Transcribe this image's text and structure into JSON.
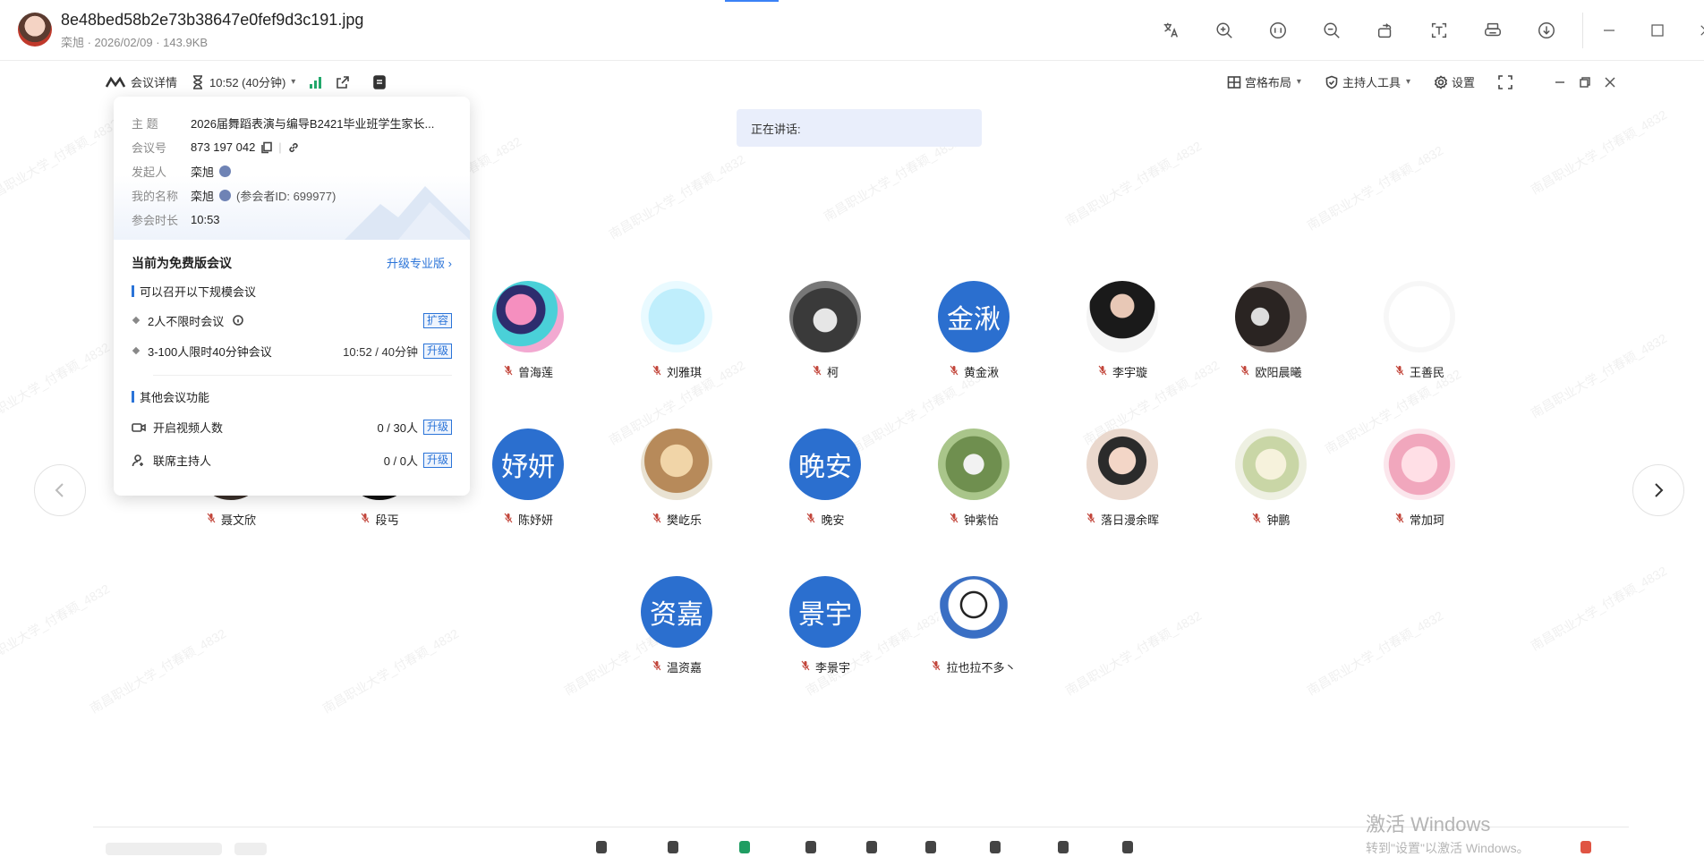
{
  "viewer": {
    "filename": "8e48bed58b2e73b38647e0fef9d3c191.jpg",
    "meta": "栾旭 · 2026/02/09 · 143.9KB",
    "tools": [
      "translate-icon",
      "zoom-in-icon",
      "actual-size-icon",
      "zoom-out-icon",
      "rotate-icon",
      "text-extract-icon",
      "print-icon",
      "download-icon"
    ],
    "window": [
      "minimize-icon",
      "maximize-icon",
      "close-icon"
    ]
  },
  "meeting_bar": {
    "details_label": "会议详情",
    "timer": "10:52 (40分钟)",
    "grid_layout": "宫格布局",
    "host_tools": "主持人工具",
    "settings": "设置"
  },
  "speaking": {
    "label": "正在讲话:"
  },
  "info": {
    "topic_key": "主 题",
    "topic": "2026届舞蹈表演与编导B2421毕业班学生家长...",
    "id_key": "会议号",
    "id": "873 197 042",
    "host_key": "发起人",
    "host": "栾旭",
    "myname_key": "我的名称",
    "myname": "栾旭",
    "participant_id": "(参会者ID: 699977)",
    "duration_key": "参会时长",
    "duration": "10:53",
    "free_title": "当前为免费版会议",
    "upgrade_pro": "升级专业版",
    "section1": "可以召开以下规模会议",
    "item1": "2人不限时会议",
    "item1_tag": "扩容",
    "item2": "3-100人限时40分钟会议",
    "item2_value": "10:52 / 40分钟",
    "item2_tag": "升级",
    "section2": "其他会议功能",
    "item3": "开启视频人数",
    "item3_value": "0 / 30人",
    "item3_tag": "升级",
    "item4": "联席主持人",
    "item4_value": "0 / 0人",
    "item4_tag": "升级"
  },
  "participants": [
    {
      "name": "曾海莲",
      "avatar": "photo"
    },
    {
      "name": "刘雅琪",
      "avatar": "photo"
    },
    {
      "name": "柯",
      "avatar": "photo"
    },
    {
      "name": "黄金湫",
      "avatar": "金湫"
    },
    {
      "name": "李宇璇",
      "avatar": "photo"
    },
    {
      "name": "欧阳晨曦",
      "avatar": "photo"
    },
    {
      "name": "王善民",
      "avatar": "photo"
    },
    {
      "name": "聂文欣",
      "avatar": "photo"
    },
    {
      "name": "段丐",
      "avatar": "photo"
    },
    {
      "name": "陈妤妍",
      "avatar": "妤妍"
    },
    {
      "name": "樊屹乐",
      "avatar": "photo"
    },
    {
      "name": "晚安",
      "avatar": "晚安"
    },
    {
      "name": "钟紫怡",
      "avatar": "photo"
    },
    {
      "name": "落日漫余晖",
      "avatar": "photo"
    },
    {
      "name": "钟鹏",
      "avatar": "photo"
    },
    {
      "name": "常加珂",
      "avatar": "photo"
    },
    {
      "name": "温资嘉",
      "avatar": "资嘉"
    },
    {
      "name": "李景宇",
      "avatar": "景宇"
    },
    {
      "name": "拉也拉不多丶",
      "avatar": "photo"
    }
  ],
  "watermark": "南昌职业大学_付春颖_4832",
  "windows_activation": {
    "line1": "激活 Windows",
    "line2": "转到\"设置\"以激活 Windows。"
  },
  "colors": {
    "accent": "#2b74d8",
    "avatar_text_bg": "#2b6fcf",
    "signal": "#22a86b"
  }
}
